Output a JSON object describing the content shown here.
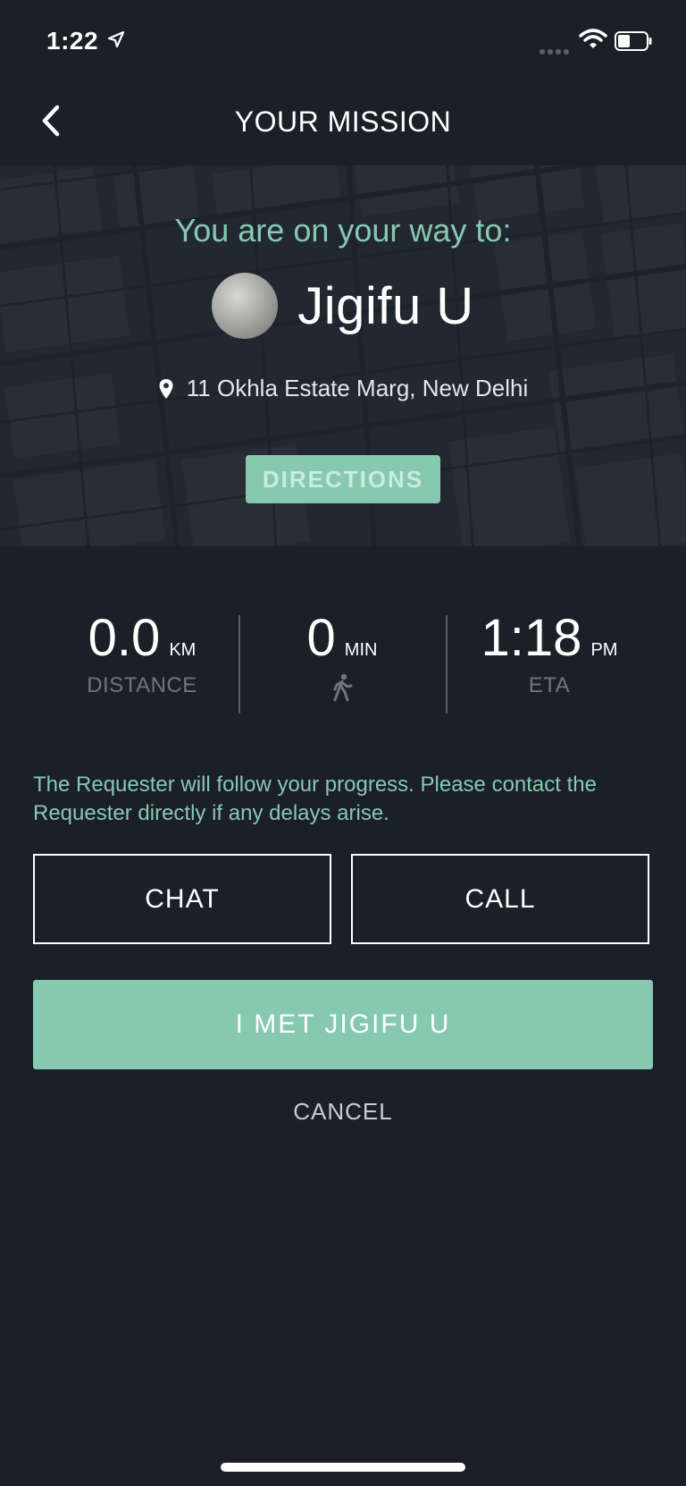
{
  "status_bar": {
    "time": "1:22"
  },
  "nav": {
    "title": "YOUR MISSION"
  },
  "hero": {
    "heading": "You are on your way to:",
    "person_name": "Jigifu U",
    "address": "11 Okhla Estate Marg, New Delhi",
    "directions_label": "DIRECTIONS"
  },
  "stats": {
    "distance": {
      "value": "0.0",
      "unit": "KM",
      "label": "DISTANCE"
    },
    "duration": {
      "value": "0",
      "unit": "MIN",
      "icon": "walking-icon"
    },
    "eta": {
      "value": "1:18",
      "unit": "PM",
      "label": "ETA"
    }
  },
  "info_text": "The Requester will follow your progress. Please contact the Requester directly if any delays arise.",
  "actions": {
    "chat_label": "CHAT",
    "call_label": "CALL",
    "met_label": "I MET JIGIFU U",
    "cancel_label": "CANCEL"
  },
  "colors": {
    "background": "#1b1f27",
    "accent": "#87c8b1",
    "muted": "#6f7580"
  }
}
